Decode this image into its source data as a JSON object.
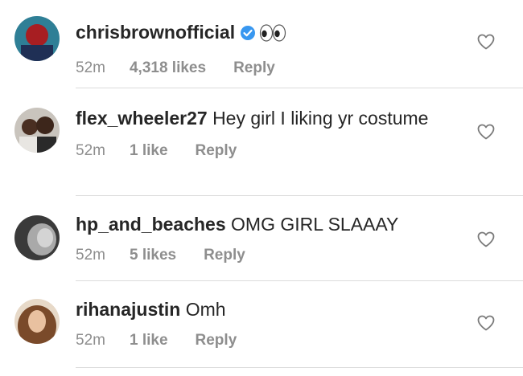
{
  "comments": [
    {
      "username": "chrisbrownofficial",
      "verified": true,
      "text": "",
      "emoji": "eyes-emoji",
      "time": "52m",
      "likes": "4,318 likes",
      "reply_label": "Reply"
    },
    {
      "username": "flex_wheeler27",
      "verified": false,
      "text": "Hey girl I liking yr costume",
      "time": "52m",
      "likes": "1 like",
      "reply_label": "Reply"
    },
    {
      "username": "hp_and_beaches",
      "verified": false,
      "text": "OMG GIRL SLAAAY",
      "time": "52m",
      "likes": "5 likes",
      "reply_label": "Reply"
    },
    {
      "username": "rihanajustin",
      "verified": false,
      "text": "Omh",
      "time": "52m",
      "likes": "1 like",
      "reply_label": "Reply"
    }
  ],
  "colors": {
    "text": "#262626",
    "meta": "#8e8e8e",
    "verified": "#3897f0",
    "divider": "#dbdbdb"
  }
}
